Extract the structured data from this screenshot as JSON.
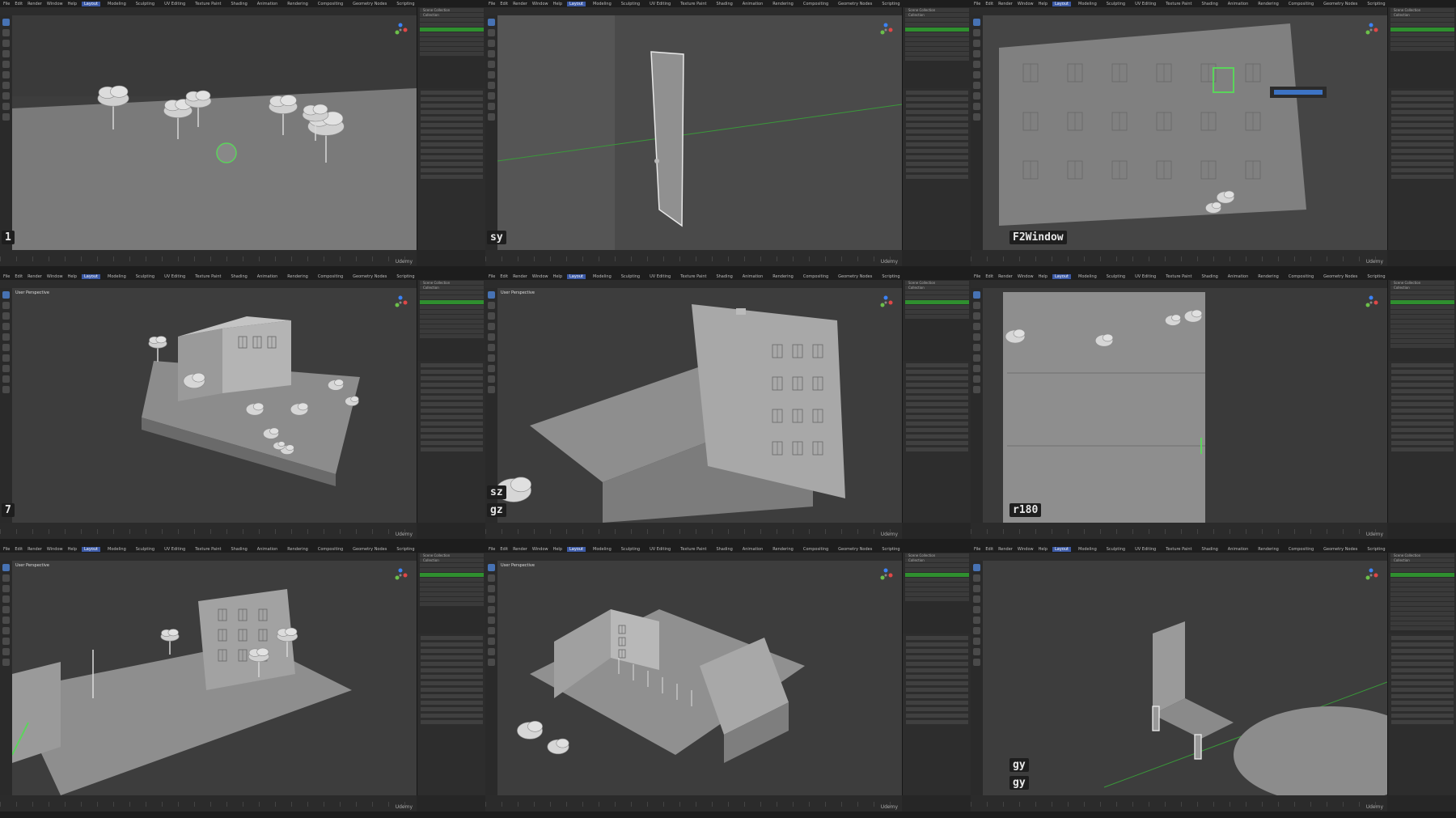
{
  "menu": [
    "File",
    "Edit",
    "Render",
    "Window",
    "Help"
  ],
  "workspaces": [
    "Layout",
    "Modeling",
    "Sculpting",
    "UV Editing",
    "Texture Paint",
    "Shading",
    "Animation",
    "Rendering",
    "Compositing",
    "Geometry Nodes",
    "Scripting"
  ],
  "active_workspace": "Layout",
  "viewport_label": "User Perspective",
  "scene_collection": "Scene Collection",
  "collection": "Collection",
  "watermark": "Udemy",
  "panels": [
    {
      "id": "p1",
      "keys": [
        "1"
      ]
    },
    {
      "id": "p2",
      "keys": [
        "sy"
      ]
    },
    {
      "id": "p3",
      "keys": [
        "F2Window"
      ]
    },
    {
      "id": "p4",
      "keys": [
        "7"
      ]
    },
    {
      "id": "p5",
      "keys": [
        "sz",
        "gz"
      ]
    },
    {
      "id": "p6",
      "keys": [
        "r180"
      ]
    },
    {
      "id": "p7",
      "keys": []
    },
    {
      "id": "p8",
      "keys": []
    },
    {
      "id": "p9",
      "keys": [
        "gy",
        "gy"
      ]
    }
  ],
  "colors": {
    "viewport": "#3d3d3d",
    "selection": "#5bd45b",
    "ui_dark": "#262626",
    "accent": "#4772b3"
  }
}
